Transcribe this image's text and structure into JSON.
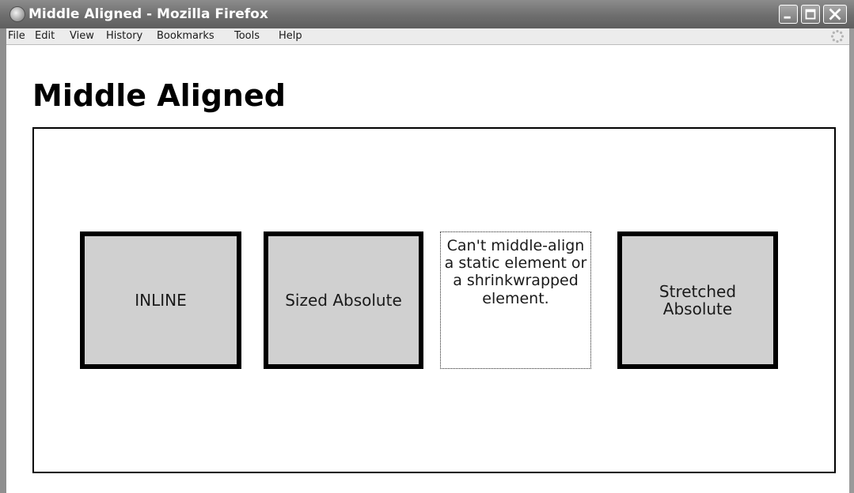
{
  "window": {
    "title": "Middle Aligned - Mozilla Firefox"
  },
  "menu": [
    "File",
    "Edit",
    "View",
    "History",
    "Bookmarks",
    "Tools",
    "Help"
  ],
  "page": {
    "heading": "Middle Aligned",
    "boxes": {
      "inline": "INLINE",
      "sized_absolute": "Sized Absolute",
      "static_note": "Can't middle-align a static element or a shrinkwrapped element.",
      "stretched_absolute": "Stretched Absolute"
    }
  },
  "icons": {
    "app": "firefox-icon",
    "minimize": "minimize-icon",
    "maximize": "maximize-icon",
    "close": "close-icon",
    "activity": "throbber-icon"
  },
  "colors": {
    "titlebar": "#6e6e6e",
    "box_fill": "#d0d0d0",
    "box_border": "#000000"
  }
}
